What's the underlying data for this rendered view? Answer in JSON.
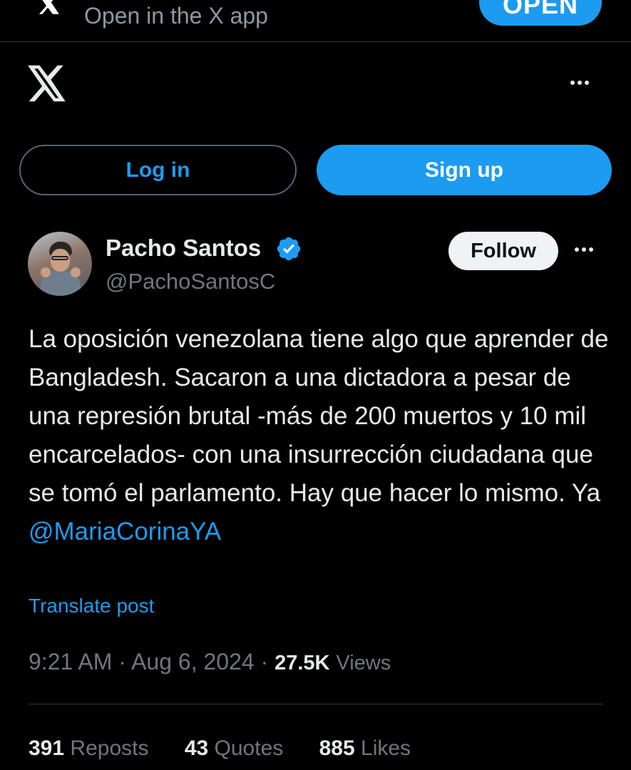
{
  "banner": {
    "text": "Open in the X app",
    "open_label": "OPEN"
  },
  "header": {
    "logo_icon": "x-logo-icon",
    "more_icon": "more-icon"
  },
  "auth": {
    "login_label": "Log in",
    "signup_label": "Sign up"
  },
  "post": {
    "author_name": "Pacho Santos",
    "author_handle": "@PachoSantosC",
    "verified": true,
    "follow_label": "Follow",
    "text_body": "La oposición venezolana tiene algo que aprender de Bangladesh. Sacaron a una dictadora a pesar de una represión brutal -más de 200 muertos y 10 mil encarcelados- con una insurrección ciudadana que se tomó el parlamento. Hay que hacer lo mismo. Ya",
    "mention": "@MariaCorinaYA",
    "translate_label": "Translate post",
    "time": "9:21 AM",
    "separator": "·",
    "date": "Aug 6, 2024",
    "views_count": "27.5K",
    "views_label": "Views",
    "stats": {
      "reposts_count": "391",
      "reposts_label": "Reposts",
      "quotes_count": "43",
      "quotes_label": "Quotes",
      "likes_count": "885",
      "likes_label": "Likes"
    }
  },
  "colors": {
    "accent": "#1d9bf0",
    "background": "#000000",
    "muted": "#71767b",
    "text": "#e7e9ea"
  }
}
